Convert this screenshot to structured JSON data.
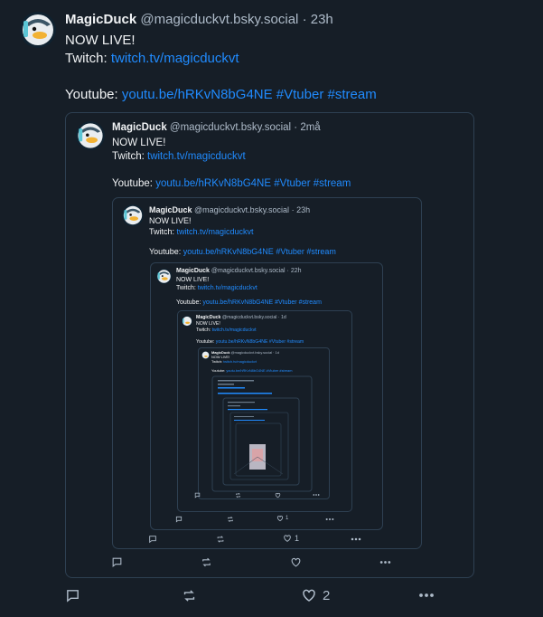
{
  "post": {
    "author": "MagicDuck",
    "handle": "@magicduckvt.bsky.social",
    "time": "23h",
    "line1": "NOW LIVE!",
    "twitch_label": "Twitch:",
    "twitch_link": "twitch.tv/magicduckvt",
    "youtube_label": "Youtube:",
    "youtube_link": "youtu.be/hRKvN8bG4NE",
    "tag1": "#Vtuber",
    "tag2": "#stream",
    "like_count": "2"
  },
  "quote1": {
    "author": "MagicDuck",
    "handle": "@magicduckvt.bsky.social",
    "time": "2må",
    "line1": "NOW LIVE!",
    "twitch_label": "Twitch:",
    "twitch_link": "twitch.tv/magicduckvt",
    "youtube_label": "Youtube:",
    "youtube_link": "youtu.be/hRKvN8bG4NE",
    "tag1": "#Vtuber",
    "tag2": "#stream"
  },
  "quote2": {
    "author": "MagicDuck",
    "handle": "@magicduckvt.bsky.social",
    "time": "23h",
    "line1": "NOW LIVE!",
    "twitch_label": "Twitch:",
    "twitch_link": "twitch.tv/magicduckvt",
    "youtube_label": "Youtube:",
    "youtube_link": "youtu.be/hRKvN8bG4NE",
    "tag1": "#Vtuber",
    "tag2": "#stream",
    "like_count": "1"
  },
  "quote3": {
    "author": "MagicDuck",
    "handle": "@magicduckvt.bsky.social",
    "time": "22h",
    "line1": "NOW LIVE!",
    "twitch_label": "Twitch:",
    "twitch_link": "twitch.tv/magicduckvt",
    "youtube_label": "Youtube:",
    "youtube_link": "youtu.be/hRKvN8bG4NE",
    "tag1": "#Vtuber",
    "tag2": "#stream",
    "like_count": "1"
  },
  "quote4": {
    "author": "MagicDuck",
    "handle": "@magicduckvt.bsky.social",
    "time": "1d",
    "line1": "NOW LIVE!",
    "twitch_label": "Twitch:",
    "twitch_link": "twitch.tv/magicduckvt",
    "youtube_label": "Youtube:",
    "youtube_link": "youtu.be/hRKvN8bG4NE",
    "tag1": "#Vtuber",
    "tag2": "#stream"
  },
  "quote5": {
    "author": "MagicDuck",
    "handle": "@magicduckvt.bsky.social",
    "time": "1d",
    "line1": "NOW LIVE!",
    "twitch_label": "Twitch:",
    "twitch_link": "twitch.tv/magicduckvt",
    "youtube_label": "Youtube:",
    "youtube_link": "youtu.be/hRKvN8bG4NE",
    "tag1": "#Vtuber",
    "tag2": "#stream"
  },
  "colors": {
    "background": "#161e27",
    "link": "#208bfe",
    "border": "#2e4052",
    "muted": "#aebbc9"
  },
  "icons": [
    "reply-icon",
    "repost-icon",
    "like-icon",
    "more-icon"
  ]
}
